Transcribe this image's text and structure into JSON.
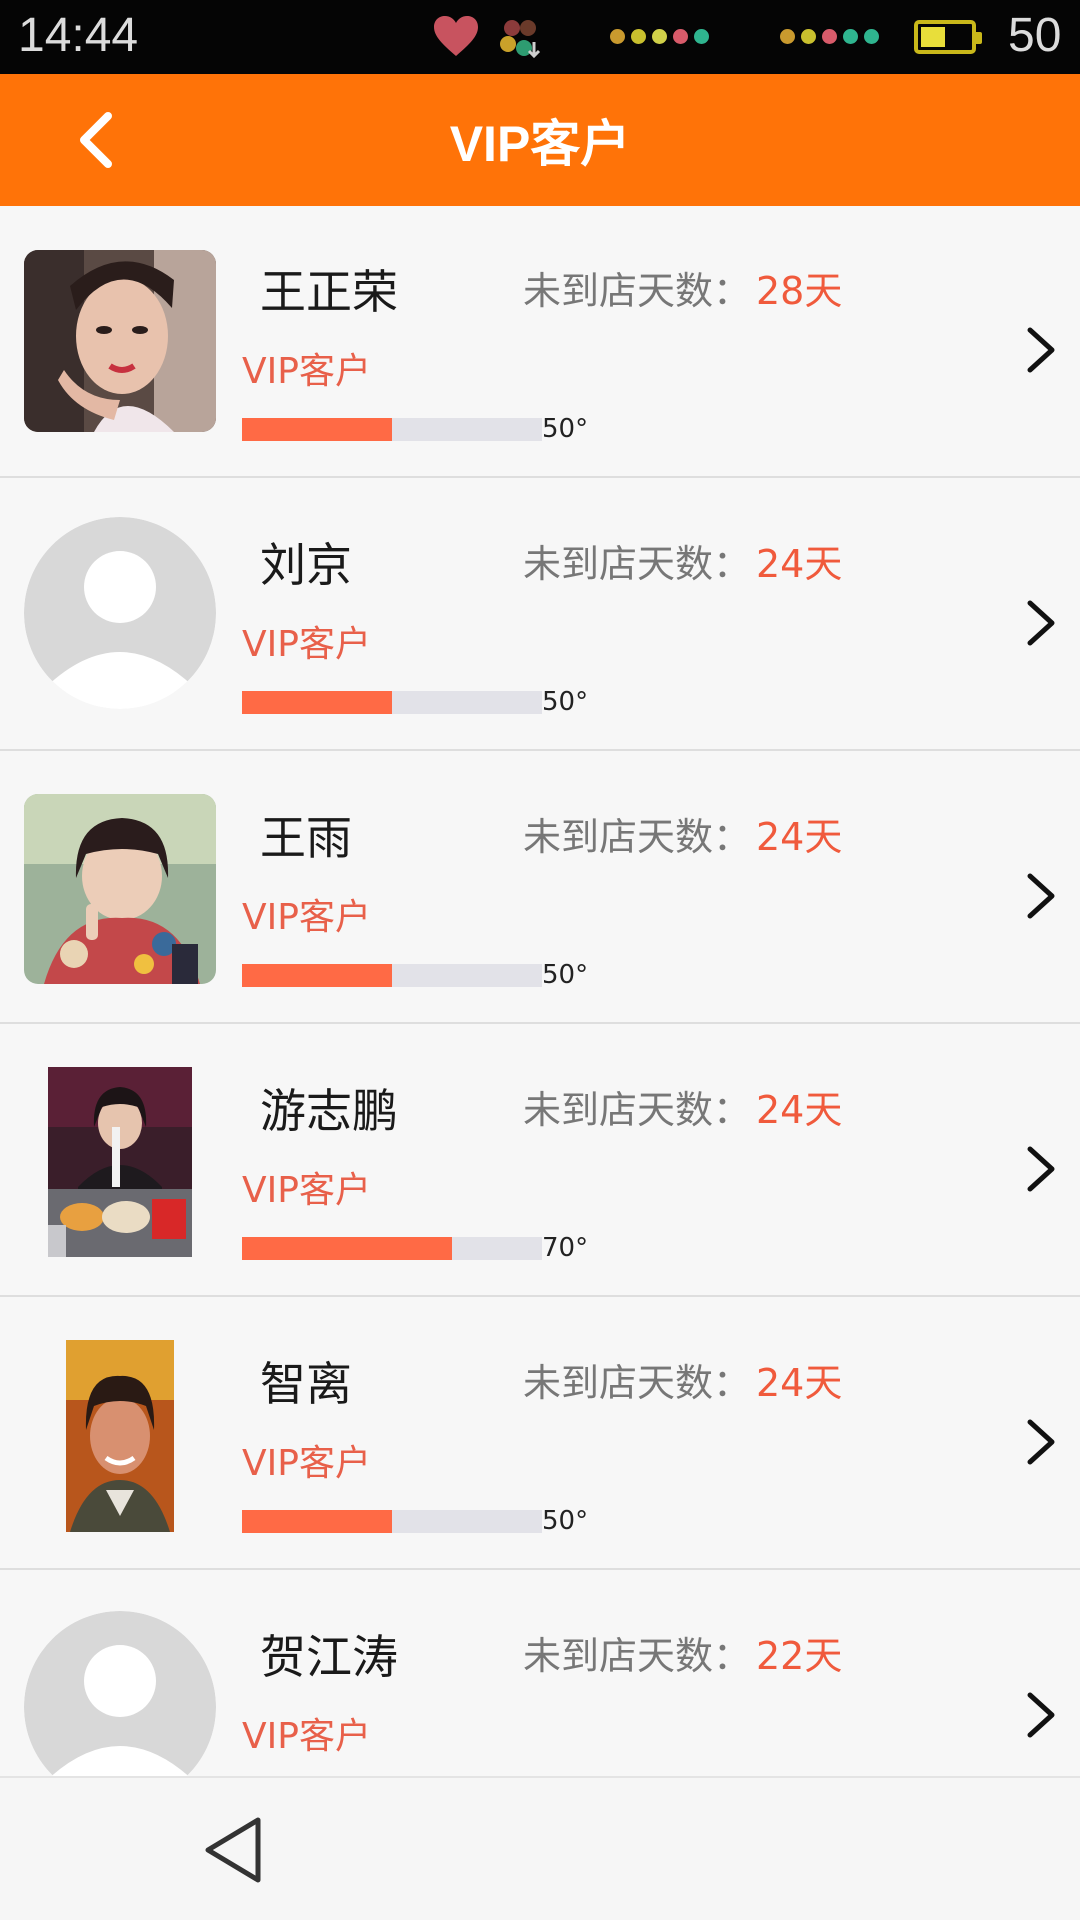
{
  "status_bar": {
    "time": "14:44",
    "battery_level": "50",
    "icons": [
      "heart-icon",
      "app-icon",
      "signal-icon",
      "signal-icon",
      "battery-icon"
    ],
    "signal_colors": [
      "#c99a2e",
      "#c99a2e",
      "#d0d049",
      "#d85b6a",
      "#2fb58f"
    ]
  },
  "header": {
    "title": "VIP客户",
    "back_icon": "chevron-left-icon",
    "background": "#ff7308"
  },
  "customers": [
    {
      "name": "王正荣",
      "days_label": "未到店天数：",
      "days_value": "28天",
      "vip_label": "VIP客户",
      "progress": 0.5,
      "progress_text": "50°",
      "avatar": "photo-woman-selfie"
    },
    {
      "name": "刘京",
      "days_label": "未到店天数：",
      "days_value": "24天",
      "vip_label": "VIP客户",
      "progress": 0.5,
      "progress_text": "50°",
      "avatar": "default-avatar"
    },
    {
      "name": "王雨",
      "days_label": "未到店天数：",
      "days_value": "24天",
      "vip_label": "VIP客户",
      "progress": 0.5,
      "progress_text": "50°",
      "avatar": "photo-girl-peace-sign"
    },
    {
      "name": "游志鹏",
      "days_label": "未到店天数：",
      "days_value": "24天",
      "vip_label": "VIP客户",
      "progress": 0.7,
      "progress_text": "70°",
      "avatar": "photo-girl-fast-food"
    },
    {
      "name": "智离",
      "days_label": "未到店天数：",
      "days_value": "24天",
      "vip_label": "VIP客户",
      "progress": 0.5,
      "progress_text": "50°",
      "avatar": "photo-older-woman"
    },
    {
      "name": "贺江涛",
      "days_label": "未到店天数：",
      "days_value": "22天",
      "vip_label": "VIP客户",
      "progress": null,
      "progress_text": "",
      "avatar": "default-avatar"
    }
  ],
  "nav_bar": {
    "back_icon": "triangle-back-icon"
  },
  "colors": {
    "accent": "#ff7308",
    "days_value": "#f05a3c",
    "vip_label": "#e8604a",
    "progress_fill": "#ff6a45",
    "progress_track": "#e2e2e8"
  }
}
